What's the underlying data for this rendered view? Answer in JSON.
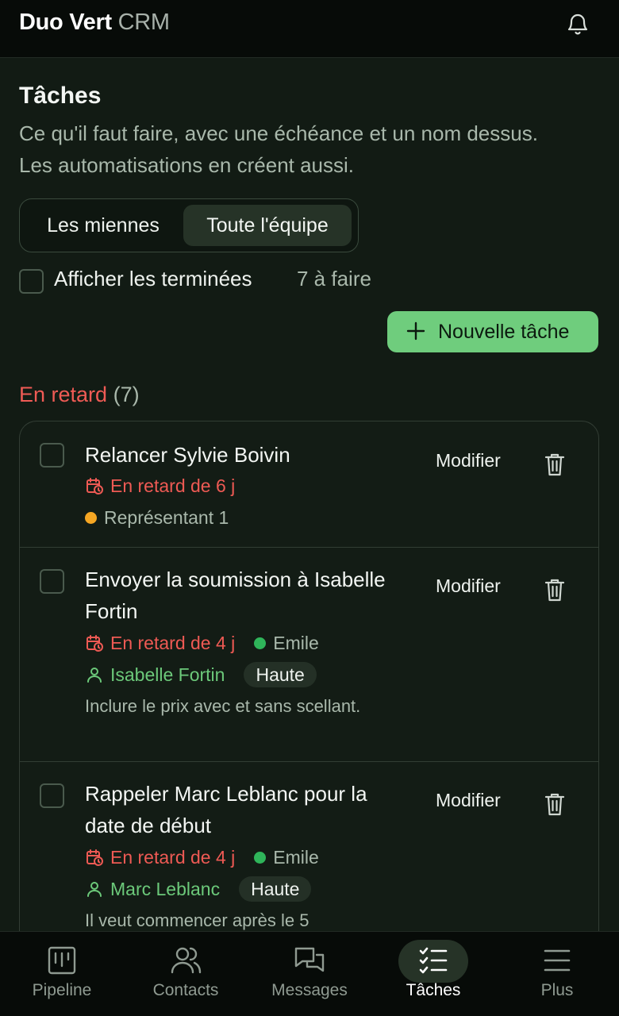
{
  "header": {
    "brand_main": "Duo Vert",
    "brand_sub": "CRM",
    "bell_icon": "bell-icon"
  },
  "page": {
    "title": "Tâches",
    "description": "Ce qu'il faut faire, avec une échéance et un nom dessus. Les automatisations en créent aussi."
  },
  "filter": {
    "tabs": [
      "Les miennes",
      "Toute l'équipe"
    ],
    "selected": "Toute l'équipe",
    "show_completed_label": "Afficher les terminées",
    "show_completed_checked": false,
    "todo_count": "7 à faire"
  },
  "new_task_button": {
    "label": "Nouvelle tâche",
    "icon": "plus-icon"
  },
  "section": {
    "name": "En retard",
    "count": "(7)"
  },
  "tasks": [
    {
      "title": "Relancer Sylvie Boivin",
      "overdue": "En retard de 6 j",
      "assignee": "Représentant 1",
      "assignee_color": "#f5a623",
      "edit_label": "Modifier"
    },
    {
      "title": "Envoyer la soumission à Isabelle Fortin",
      "overdue": "En retard de 4 j",
      "assignee": "Emile",
      "assignee_color": "#2fb55a",
      "contact": "Isabelle Fortin",
      "priority": "Haute",
      "note": "Inclure le prix avec et sans scellant.",
      "edit_label": "Modifier"
    },
    {
      "title": "Rappeler Marc Leblanc pour la date de début",
      "overdue": "En retard de 4 j",
      "assignee": "Emile",
      "assignee_color": "#2fb55a",
      "contact": "Marc Leblanc",
      "priority": "Haute",
      "note": "Il veut commencer après le 5",
      "edit_label": "Modifier"
    }
  ],
  "bottom_nav": [
    {
      "label": "Pipeline",
      "icon": "pipeline-icon",
      "active": false
    },
    {
      "label": "Contacts",
      "icon": "contacts-icon",
      "active": false
    },
    {
      "label": "Messages",
      "icon": "messages-icon",
      "active": false
    },
    {
      "label": "Tâches",
      "icon": "tasks-icon",
      "active": true
    },
    {
      "label": "Plus",
      "icon": "menu-icon",
      "active": false
    }
  ],
  "colors": {
    "accent": "#6fcd7d",
    "overdue": "#ee5a54",
    "contact": "#6cc97a"
  }
}
